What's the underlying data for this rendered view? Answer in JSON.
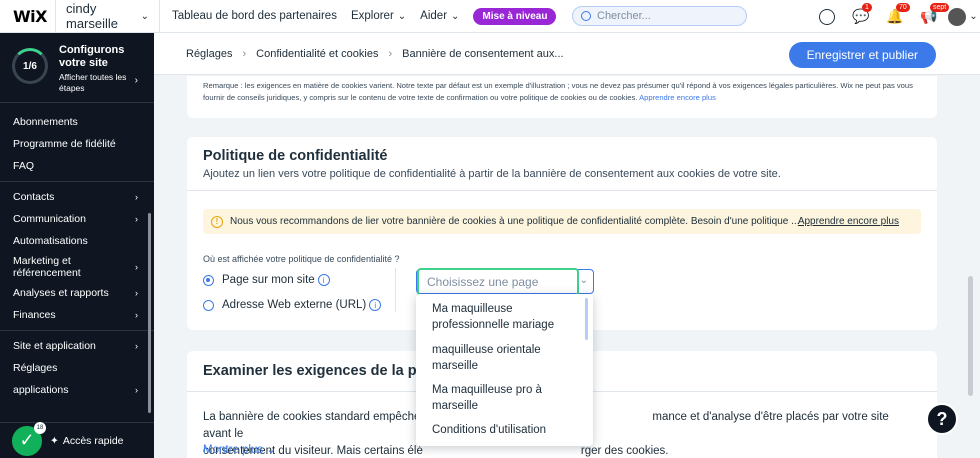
{
  "topbar": {
    "logo": "WiX",
    "site_name": "cindy marseille",
    "nav": [
      "Tableau de bord des partenaires",
      "Explorer",
      "Aider"
    ],
    "upgrade": "Mise à niveau",
    "search_placeholder": "Chercher...",
    "badges": {
      "chat": "1",
      "notifications": "70",
      "updates": "sept"
    }
  },
  "sidebar": {
    "setup_progress": "1/6",
    "setup_title": "Configurons votre site",
    "setup_sub": "Afficher toutes les étapes",
    "items": [
      {
        "label": "Abonnements",
        "arrow": false
      },
      {
        "label": "Programme de fidélité",
        "arrow": false
      },
      {
        "label": "FAQ",
        "arrow": false
      },
      {
        "label": "Contacts",
        "arrow": true
      },
      {
        "label": "Communication",
        "arrow": true
      },
      {
        "label": "Automatisations",
        "arrow": false
      },
      {
        "label": "Marketing et référencement",
        "arrow": true
      },
      {
        "label": "Analyses et rapports",
        "arrow": true
      },
      {
        "label": "Finances",
        "arrow": true
      },
      {
        "label": "Site et application",
        "arrow": true
      },
      {
        "label": "Réglages",
        "arrow": false
      },
      {
        "label": "applications",
        "arrow": true
      }
    ],
    "quick_access": "Accès rapide",
    "quick_count": "18"
  },
  "header": {
    "breadcrumbs": [
      "Réglages",
      "Confidentialité et cookies",
      "Bannière de consentement aux..."
    ],
    "publish": "Enregistrer et publier"
  },
  "remark": {
    "text": "Remarque : les exigences en matière de cookies varient. Notre texte par défaut est un exemple d'illustration ; vous ne devez pas présumer qu'il répond à vos exigences légales particulières. Wix ne peut pas vous fournir de conseils juridiques, y compris sur le contenu de votre texte de confirmation ou votre politique de cookies ou de cookies.",
    "link": "Apprendre encore plus"
  },
  "privacy": {
    "title": "Politique de confidentialité",
    "subtitle": "Ajoutez un lien vers votre politique de confidentialité à partir de la bannière de consentement aux cookies de votre site.",
    "notice": "Nous vous recommandons de lier votre bannière de cookies à une politique de confidentialité complète. Besoin d'une politique ...",
    "notice_link": "Apprendre encore plus",
    "where_label": "Où est affichée votre politique de confidentialité ?",
    "option_page": "Page sur mon site",
    "option_url": "Adresse Web externe (URL)",
    "select_placeholder": "Choisissez une page"
  },
  "dropdown": {
    "options": [
      "Ma maquilleuse professionnelle mariage",
      "maquilleuse orientale marseille",
      "Ma maquilleuse pro à marseille",
      "Conditions d'utilisation"
    ]
  },
  "requirements": {
    "title": "Examiner les exigences de la politi",
    "body_line1_a": "La bannière de cookies standard empêche",
    "body_line1_b": "mance et d'analyse d'être placés par votre site avant le",
    "body_line2_a": "consentement du visiteur. Mais certains élé",
    "body_line2_b": "rger des cookies.",
    "more": "Montre plus"
  },
  "help": "?"
}
